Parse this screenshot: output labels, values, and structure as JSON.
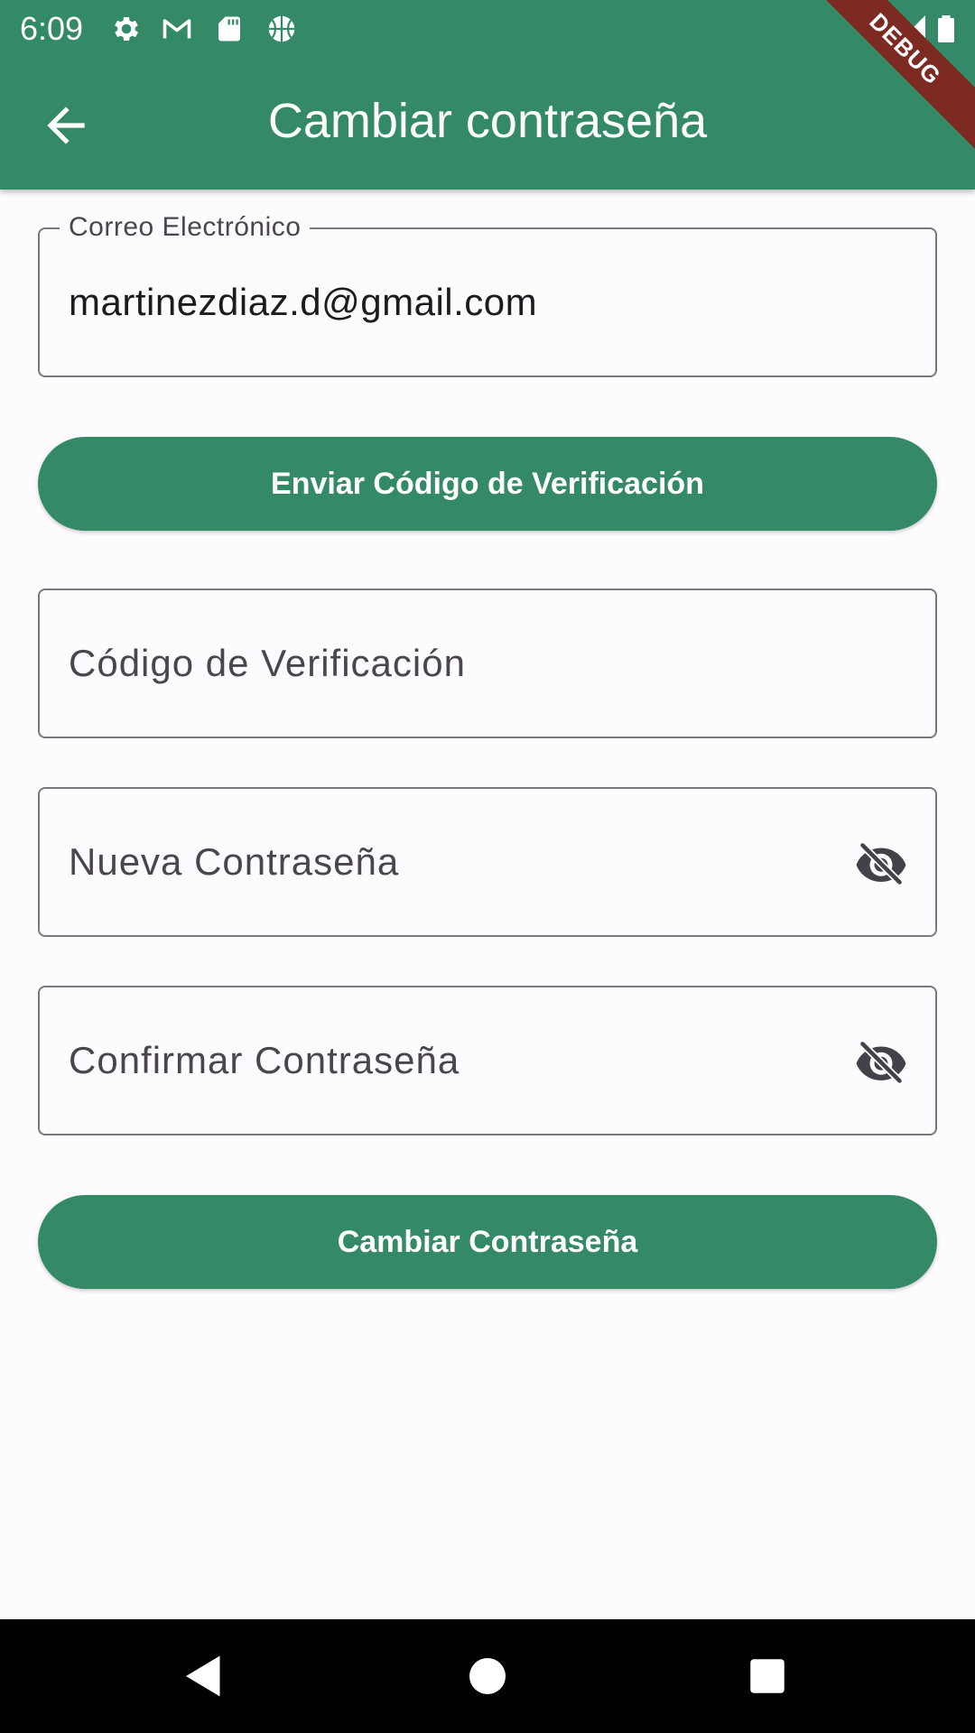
{
  "status_bar": {
    "time": "6:09",
    "icons": [
      "gear-icon",
      "gmail-icon",
      "sd-card-icon",
      "basketball-icon",
      "wifi-icon",
      "signal-icon",
      "battery-icon"
    ]
  },
  "app_bar": {
    "title": "Cambiar contraseña",
    "back_icon": "arrow-back-icon",
    "debug_banner": "DEBUG"
  },
  "form": {
    "email": {
      "label": "Correo Electrónico",
      "value": "martinezdiaz.d@gmail.com"
    },
    "send_code_button": "Enviar Código de Verificación",
    "verification_code": {
      "placeholder": "Código de Verificación"
    },
    "new_password": {
      "placeholder": "Nueva Contraseña",
      "toggle_icon": "eye-off-icon"
    },
    "confirm_password": {
      "placeholder": "Confirmar Contraseña",
      "toggle_icon": "eye-off-icon"
    },
    "change_password_button": "Cambiar Contraseña"
  },
  "nav_bar": {
    "icons": [
      "back-triangle-icon",
      "home-circle-icon",
      "recents-square-icon"
    ]
  },
  "colors": {
    "primary": "#348966",
    "background": "#fefbfe",
    "debug": "#7d2a22"
  }
}
